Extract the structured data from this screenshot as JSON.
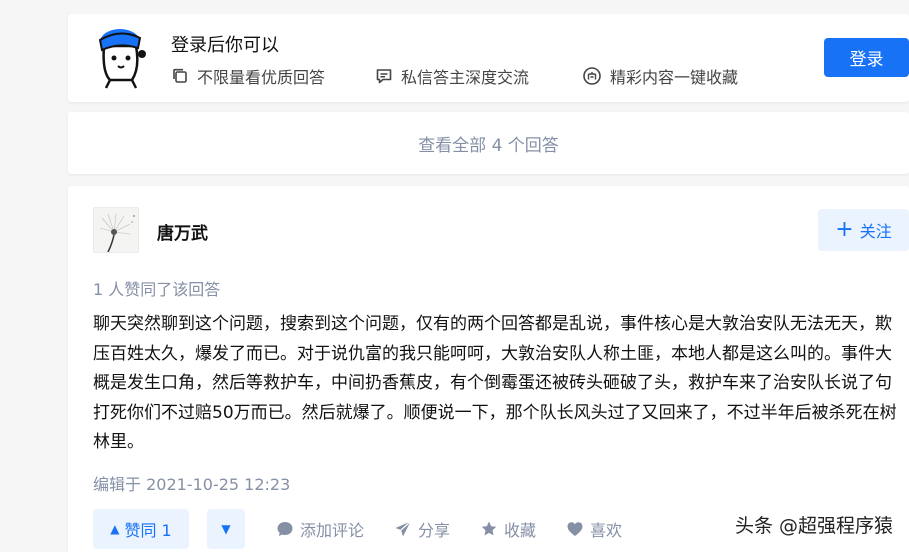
{
  "login_prompt": {
    "title": "登录后你可以",
    "features": [
      {
        "icon": "copy-icon",
        "label": "不限量看优质回答"
      },
      {
        "icon": "message-icon",
        "label": "私信答主深度交流"
      },
      {
        "icon": "collect-icon",
        "label": "精彩内容一键收藏"
      }
    ],
    "login_button": "登录"
  },
  "view_all": {
    "label": "查看全部 4 个回答"
  },
  "answer": {
    "author": "唐万武",
    "follow_label": "关注",
    "upvote_info": "1 人赞同了该回答",
    "content": "聊天突然聊到这个问题，搜索到这个问题，仅有的两个回答都是乱说，事件核心是大敦治安队无法无天，欺压百姓太久，爆发了而已。对于说仇富的我只能呵呵，大敦治安队人称土匪，本地人都是这么叫的。事件大概是发生口角，然后等救护车，中间扔香蕉皮，有个倒霉蛋还被砖头砸破了头，救护车来了治安队长说了句打死你们不过赔50万而已。然后就爆了。顺便说一下，那个队长风头过了又回来了，不过半年后被杀死在树林里。",
    "edited": "编辑于 2021-10-25 12:23",
    "vote_up_label": "赞同 1",
    "actions": {
      "comment": "添加评论",
      "share": "分享",
      "favorite": "收藏",
      "like": "喜欢"
    }
  },
  "watermark": "头条 @超强程序猿",
  "colors": {
    "accent": "#1772f6",
    "accent_light": "#eaf3fe",
    "muted": "#8590a6",
    "background": "#f6f6f6"
  }
}
